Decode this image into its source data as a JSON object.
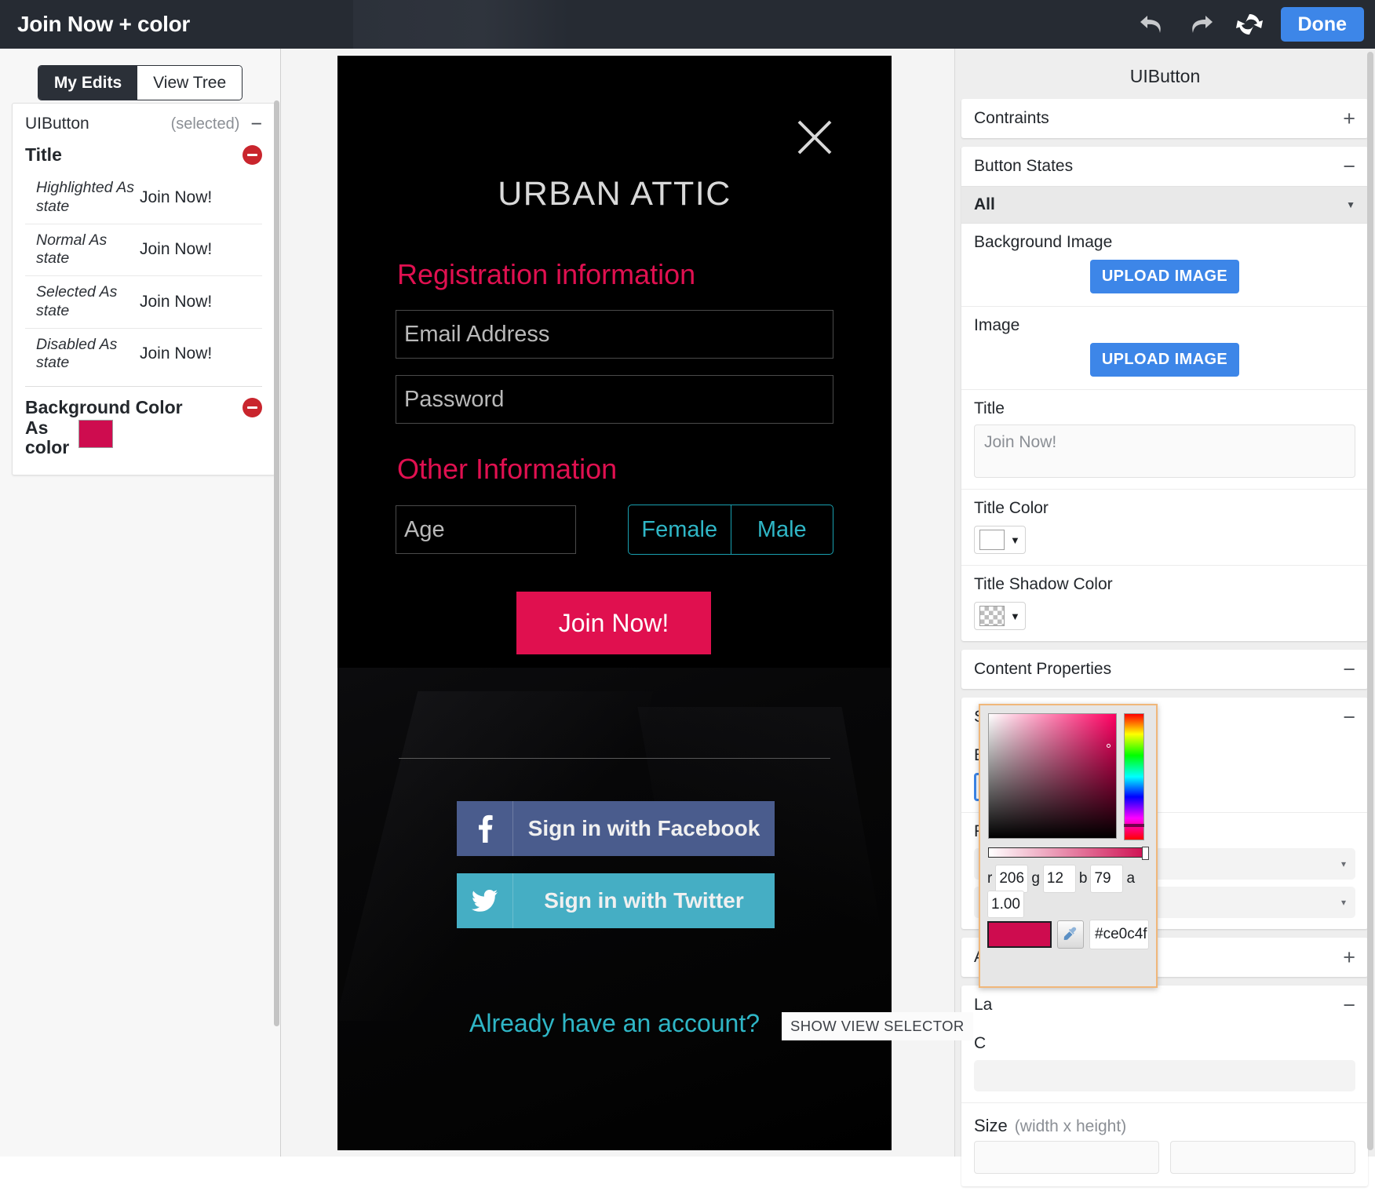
{
  "topbar": {
    "title": "Join Now + color",
    "undo_icon": "undo-icon",
    "redo_icon": "redo-icon",
    "refresh_icon": "refresh-icon",
    "done_label": "Done"
  },
  "left_panel": {
    "tabs": [
      {
        "label": "My Edits",
        "active": true
      },
      {
        "label": "View Tree",
        "active": false
      }
    ],
    "card": {
      "component": "UIButton",
      "state": "(selected)",
      "collapse_sign": "−",
      "title_section": {
        "heading": "Title",
        "remove_icon": "remove-circle-icon",
        "rows": [
          {
            "key": "Highlighted As state",
            "value": "Join Now!"
          },
          {
            "key": "Normal As state",
            "value": "Join Now!"
          },
          {
            "key": "Selected As state",
            "value": "Join Now!"
          },
          {
            "key": "Disabled As state",
            "value": "Join Now!"
          }
        ]
      },
      "bgcolor_section": {
        "heading": "Background Color",
        "as_label": "As",
        "as_label2": "color",
        "swatch_color": "#ce0c4f",
        "remove_icon": "remove-circle-icon"
      }
    }
  },
  "preview": {
    "close_icon": "close-icon",
    "brand": "URBAN ATTIC",
    "section1": "Registration information",
    "email_placeholder": "Email Address",
    "password_placeholder": "Password",
    "section2": "Other Information",
    "age_placeholder": "Age",
    "gender_options": [
      "Female",
      "Male"
    ],
    "join_button": "Join Now!",
    "join_button_color": "#e0104f",
    "facebook_label": "Sign in with Facebook",
    "facebook_color": "#4a5c8d",
    "twitter_label": "Sign in with Twitter",
    "twitter_color": "#45aec4",
    "already_account": "Already have an account?",
    "accent_color": "#e01050",
    "teal_color": "#2fb6c6",
    "show_view_selector": "SHOW VIEW SELECTOR"
  },
  "right_panel": {
    "title": "UIButton",
    "constraints": {
      "label": "Contraints",
      "sign": "+"
    },
    "button_states": {
      "label": "Button States",
      "sign": "−",
      "selected_state": "All",
      "caret": "▼",
      "background_image": {
        "label": "Background Image",
        "upload": "UPLOAD IMAGE"
      },
      "image": {
        "label": "Image",
        "upload": "UPLOAD IMAGE"
      },
      "title": {
        "label": "Title",
        "placeholder": "Join Now!"
      },
      "title_color": {
        "label": "Title Color",
        "value": "#ffffff",
        "caret": "▼"
      },
      "title_shadow_color": {
        "label": "Title Shadow Color",
        "value": "transparent",
        "caret": "▼"
      }
    },
    "content_properties": {
      "label": "Content Properties",
      "sign": "−"
    },
    "styling_properties": {
      "label": "Styling Properties",
      "sign": "−",
      "background_color": {
        "label": "Background Color",
        "value": "#ce0c4f",
        "caret": "▼"
      },
      "font_label": "Fo"
    },
    "partial_sections": [
      {
        "label": "A",
        "sign": "+"
      },
      {
        "label": "La",
        "sign": "−"
      },
      {
        "label": "C",
        "sign": ""
      }
    ],
    "size": {
      "label": "Size",
      "hint": "(width x height)"
    }
  },
  "color_picker": {
    "r_label": "r",
    "r_value": "206",
    "g_label": "g",
    "g_value": "12",
    "b_label": "b",
    "b_value": "79",
    "a_label": "a",
    "a_value": "1.00",
    "hex_value": "#ce0c4f",
    "swatch_color": "#ce0c4f",
    "eyedropper_icon": "eyedropper-icon"
  }
}
